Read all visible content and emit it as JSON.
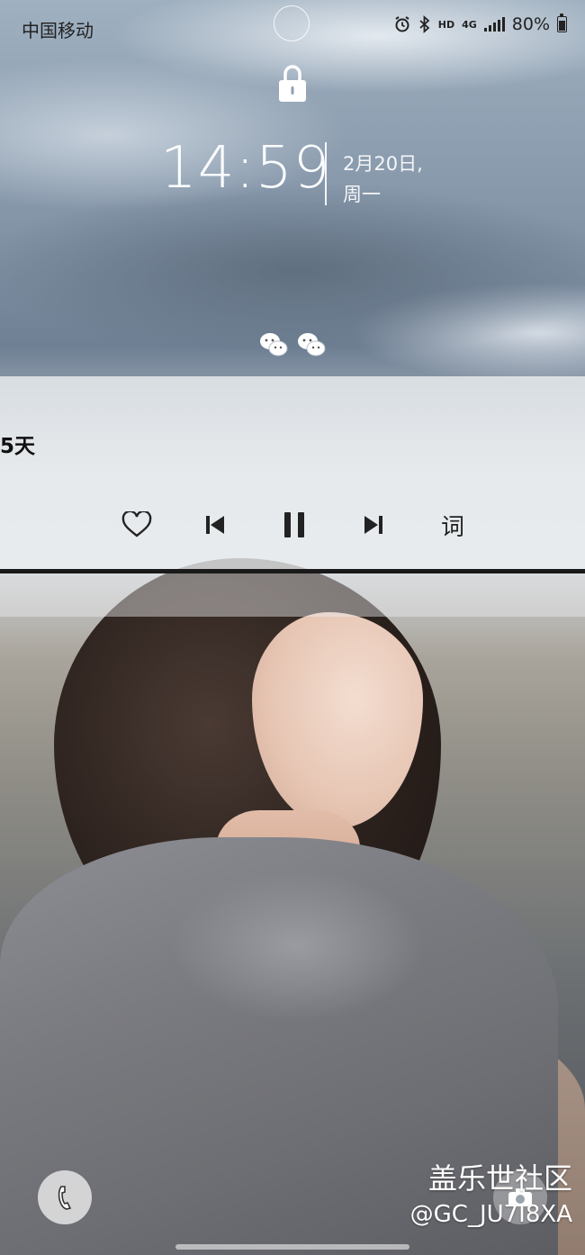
{
  "status_bar": {
    "carrier": "中国移动",
    "hd_label": "HD",
    "network_label": "4G",
    "battery": "80%",
    "icons": [
      "alarm-icon",
      "bluetooth-icon",
      "signal-icon",
      "battery-icon"
    ]
  },
  "lock_screen": {
    "time": "14:59",
    "date_line1": "2月20日,",
    "date_line2": "周一",
    "notification_icons": [
      "wechat-icon",
      "wechat-icon"
    ]
  },
  "music": {
    "title_fragment": "5天",
    "controls": [
      "heart-icon",
      "previous-icon",
      "pause-icon",
      "next-icon"
    ],
    "lyrics_label": "词"
  },
  "watermark": {
    "line1": "盖乐世社区",
    "line2": "@GC_JU7I8XA"
  },
  "colors": {
    "clock_text": "#fafcfe",
    "widget_bg": "#f0f2f4",
    "progress": "#1a1a1a"
  }
}
